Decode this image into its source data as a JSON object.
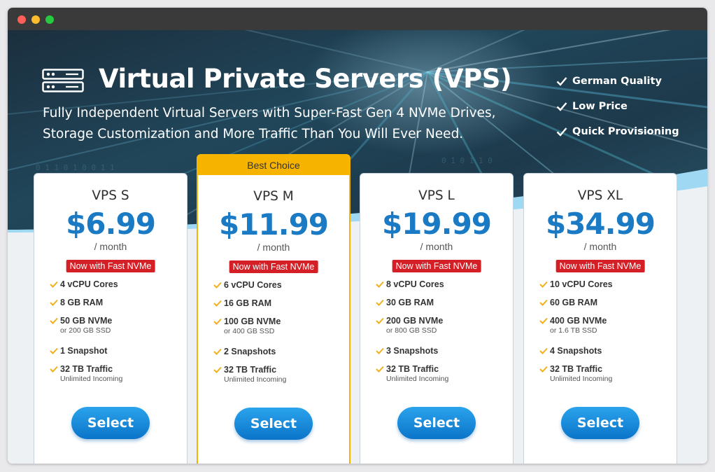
{
  "hero": {
    "title": "Virtual Private Servers (VPS)",
    "subtitle_line1": "Fully Independent Virtual Servers with Super-Fast Gen 4 NVMe Drives,",
    "subtitle_line2": "Storage Customization and More Traffic Than You Will Ever Need.",
    "features": [
      "German Quality",
      "Low Price",
      "Quick Provisioning"
    ],
    "icon": "server-icon"
  },
  "colors": {
    "price": "#1a7ac4",
    "badge": "#d41f26",
    "ribbon": "#f6b400",
    "check": "#f2b01e",
    "button": "#0b74c9"
  },
  "plans": [
    {
      "name": "VPS S",
      "price": "$6.99",
      "period": "/ month",
      "badge": "Now with Fast NVMe",
      "specs": [
        {
          "main": "4 vCPU Cores",
          "sub": ""
        },
        {
          "main": "8 GB RAM",
          "sub": ""
        },
        {
          "main": "50 GB NVMe",
          "sub": "or 200 GB SSD"
        },
        {
          "main": "1 Snapshot",
          "sub": ""
        },
        {
          "main": "32 TB Traffic",
          "sub": "Unlimited Incoming"
        }
      ],
      "button": "Select"
    },
    {
      "name": "VPS M",
      "price": "$11.99",
      "period": "/ month",
      "badge": "Now with Fast NVMe",
      "ribbon": "Best Choice",
      "specs": [
        {
          "main": "6 vCPU Cores",
          "sub": ""
        },
        {
          "main": "16 GB RAM",
          "sub": ""
        },
        {
          "main": "100 GB NVMe",
          "sub": "or 400 GB SSD"
        },
        {
          "main": "2 Snapshots",
          "sub": ""
        },
        {
          "main": "32 TB Traffic",
          "sub": "Unlimited Incoming"
        }
      ],
      "button": "Select"
    },
    {
      "name": "VPS L",
      "price": "$19.99",
      "period": "/ month",
      "badge": "Now with Fast NVMe",
      "specs": [
        {
          "main": "8 vCPU Cores",
          "sub": ""
        },
        {
          "main": "30 GB RAM",
          "sub": ""
        },
        {
          "main": "200 GB NVMe",
          "sub": "or 800 GB SSD"
        },
        {
          "main": "3 Snapshots",
          "sub": ""
        },
        {
          "main": "32 TB Traffic",
          "sub": "Unlimited Incoming"
        }
      ],
      "button": "Select"
    },
    {
      "name": "VPS XL",
      "price": "$34.99",
      "period": "/ month",
      "badge": "Now with Fast NVMe",
      "specs": [
        {
          "main": "10 vCPU Cores",
          "sub": ""
        },
        {
          "main": "60 GB RAM",
          "sub": ""
        },
        {
          "main": "400 GB NVMe",
          "sub": "or 1.6 TB SSD"
        },
        {
          "main": "4 Snapshots",
          "sub": ""
        },
        {
          "main": "32 TB Traffic",
          "sub": "Unlimited Incoming"
        }
      ],
      "button": "Select"
    }
  ]
}
